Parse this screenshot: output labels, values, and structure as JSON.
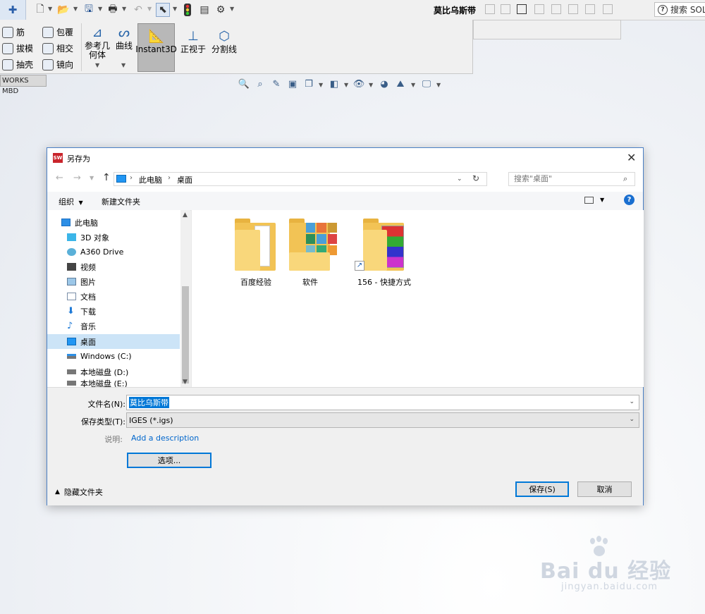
{
  "window": {
    "title": "莫比乌斯带",
    "search_label": "搜索 SOLI"
  },
  "ribbon": {
    "rib": "筋",
    "wrap": "包覆",
    "draft": "拔模",
    "intersect": "相交",
    "shell": "抽壳",
    "mirror": "镜向",
    "ref_geometry": "参考几何体",
    "curves": "曲线",
    "instant3d": "Instant3D",
    "normal_to": "正视于",
    "split_line": "分割线"
  },
  "mbd_tab": "WORKS MBD",
  "dialog": {
    "title": "另存为",
    "breadcrumb": [
      "此电脑",
      "桌面"
    ],
    "search_placeholder": "搜索\"桌面\"",
    "organize": "组织",
    "new_folder": "新建文件夹",
    "nav_items": [
      {
        "label": "此电脑",
        "icon": "computer-icon"
      },
      {
        "label": "3D 对象",
        "icon": "3d-objects-icon"
      },
      {
        "label": "A360 Drive",
        "icon": "cloud-drive-icon"
      },
      {
        "label": "视频",
        "icon": "video-icon"
      },
      {
        "label": "图片",
        "icon": "picture-icon"
      },
      {
        "label": "文档",
        "icon": "document-icon"
      },
      {
        "label": "下载",
        "icon": "download-icon"
      },
      {
        "label": "音乐",
        "icon": "music-icon"
      },
      {
        "label": "桌面",
        "icon": "desktop-icon"
      },
      {
        "label": "Windows (C:)",
        "icon": "drive-icon"
      },
      {
        "label": "本地磁盘 (D:)",
        "icon": "drive-icon"
      },
      {
        "label": "本地磁盘 (E:)",
        "icon": "drive-icon"
      }
    ],
    "files": [
      {
        "name": "百度经验",
        "icon": "folder-icon"
      },
      {
        "name": "软件",
        "icon": "folder-pictures-icon"
      },
      {
        "name": "156 - 快捷方式",
        "icon": "folder-shortcut-icon"
      }
    ],
    "filename_label": "文件名(N):",
    "filename_value": "莫比乌斯带",
    "filetype_label": "保存类型(T):",
    "filetype_value": "IGES (*.igs)",
    "desc_label": "说明:",
    "desc_link": "Add a description",
    "options_button": "选项...",
    "hide_folders": "隐藏文件夹",
    "save_button": "保存(S)",
    "cancel_button": "取消"
  },
  "watermark": {
    "logo": "Bai du 经验",
    "url": "jingyan.baidu.com"
  },
  "colors": {
    "accent": "#0078d7",
    "folder": "#f9d77b",
    "link": "#0066cc"
  }
}
